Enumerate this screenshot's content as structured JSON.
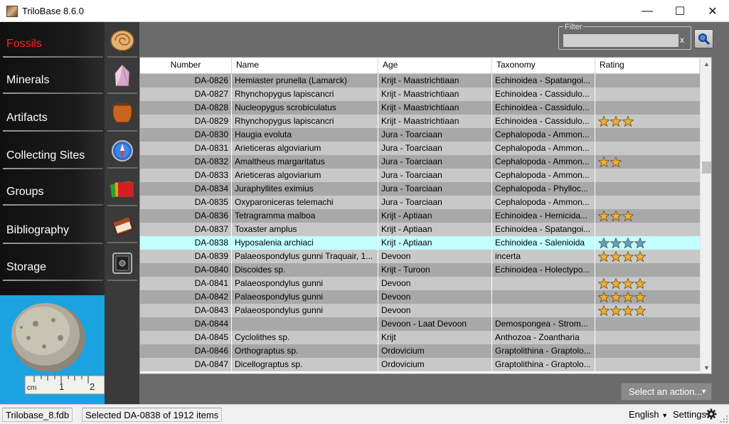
{
  "window": {
    "title": "TriloBase 8.6.0",
    "minimize": "—",
    "maximize": "☐",
    "close": "✕"
  },
  "sidebar": {
    "items": [
      {
        "label": "Fossils",
        "icon": "ammonite-icon",
        "active": true
      },
      {
        "label": "Minerals",
        "icon": "mineral-crystal-icon",
        "active": false
      },
      {
        "label": "Artifacts",
        "icon": "pottery-icon",
        "active": false
      },
      {
        "label": "Collecting Sites",
        "icon": "compass-icon",
        "active": false
      },
      {
        "label": "Groups",
        "icon": "folders-icon",
        "active": false
      },
      {
        "label": "Bibliography",
        "icon": "book-icon",
        "active": false
      },
      {
        "label": "Storage",
        "icon": "safe-icon",
        "active": false
      }
    ],
    "photo_scale_labels": [
      "cm",
      "1",
      "2"
    ]
  },
  "filter": {
    "legend": "Filter",
    "value": "",
    "clear": "x"
  },
  "table": {
    "columns": [
      "Number",
      "Name",
      "Age",
      "Taxonomy",
      "Rating"
    ],
    "rows": [
      {
        "number": "DA-0826",
        "name": "Hemiaster prunella (Lamarck)",
        "age": "Krijt - Maastrichtiaan",
        "taxonomy": "Echinoidea - Spatangoi...",
        "rating": 0
      },
      {
        "number": "DA-0827",
        "name": "Rhynchopygus lapiscancri",
        "age": "Krijt - Maastrichtiaan",
        "taxonomy": "Echinoidea - Cassidulo...",
        "rating": 0
      },
      {
        "number": "DA-0828",
        "name": "Nucleopygus scrobiculatus",
        "age": "Krijt - Maastrichtiaan",
        "taxonomy": "Echinoidea - Cassidulo...",
        "rating": 0
      },
      {
        "number": "DA-0829",
        "name": "Rhynchopygus lapiscancri",
        "age": "Krijt - Maastrichtiaan",
        "taxonomy": "Echinoidea - Cassidulo...",
        "rating": 3
      },
      {
        "number": "DA-0830",
        "name": "Haugia evoluta",
        "age": "Jura - Toarciaan",
        "taxonomy": "Cephalopoda - Ammon...",
        "rating": 0
      },
      {
        "number": "DA-0831",
        "name": "Arieticeras algoviarium",
        "age": "Jura - Toarciaan",
        "taxonomy": "Cephalopoda - Ammon...",
        "rating": 0
      },
      {
        "number": "DA-0832",
        "name": "Amaltheus margaritatus",
        "age": "Jura - Toarciaan",
        "taxonomy": "Cephalopoda - Ammon...",
        "rating": 2
      },
      {
        "number": "DA-0833",
        "name": "Arieticeras algoviarium",
        "age": "Jura - Toarciaan",
        "taxonomy": "Cephalopoda - Ammon...",
        "rating": 0
      },
      {
        "number": "DA-0834",
        "name": "Juraphyllites eximius",
        "age": "Jura - Toarciaan",
        "taxonomy": "Cephalopoda - Phylloc...",
        "rating": 0
      },
      {
        "number": "DA-0835",
        "name": "Oxyparoniceras telemachi",
        "age": "Jura - Toarciaan",
        "taxonomy": "Cephalopoda - Ammon...",
        "rating": 0
      },
      {
        "number": "DA-0836",
        "name": "Tetragramma malboa",
        "age": "Krijt - Aptiaan",
        "taxonomy": "Echinoidea - Hemicida...",
        "rating": 3
      },
      {
        "number": "DA-0837",
        "name": "Toxaster amplus",
        "age": "Krijt - Aptiaan",
        "taxonomy": "Echinoidea - Spatangoi...",
        "rating": 0
      },
      {
        "number": "DA-0838",
        "name": "Hyposalenia archiaci",
        "age": "Krijt - Aptiaan",
        "taxonomy": "Echinoidea - Salenioida",
        "rating": 4,
        "selected": true
      },
      {
        "number": "DA-0839",
        "name": "Palaeospondylus gunni Traquair, 1...",
        "age": "Devoon",
        "taxonomy": "incerta",
        "rating": 4
      },
      {
        "number": "DA-0840",
        "name": "Discoides sp.",
        "age": "Krijt - Turoon",
        "taxonomy": "Echinoidea - Holectypo...",
        "rating": 0
      },
      {
        "number": "DA-0841",
        "name": "Palaeospondylus gunni",
        "age": "Devoon",
        "taxonomy": "",
        "rating": 4
      },
      {
        "number": "DA-0842",
        "name": "Palaeospondylus gunni",
        "age": "Devoon",
        "taxonomy": "",
        "rating": 4
      },
      {
        "number": "DA-0843",
        "name": "Palaeospondylus gunni",
        "age": "Devoon",
        "taxonomy": "",
        "rating": 4
      },
      {
        "number": "DA-0844",
        "name": "",
        "age": "Devoon - Laat Devoon",
        "taxonomy": "Demospongea - Strom...",
        "rating": 0
      },
      {
        "number": "DA-0845",
        "name": "Cyclolithes sp.",
        "age": "Krijt",
        "taxonomy": "Anthozoa - Zoantharia",
        "rating": 0
      },
      {
        "number": "DA-0846",
        "name": "Orthograptus sp.",
        "age": "Ordovicium",
        "taxonomy": "Graptolithina - Graptolo...",
        "rating": 0
      },
      {
        "number": "DA-0847",
        "name": "Dicellograptus sp.",
        "age": "Ordovicium",
        "taxonomy": "Graptolithina - Graptolo...",
        "rating": 0
      }
    ]
  },
  "actions": {
    "label": "Select an action..."
  },
  "status": {
    "database": "Trilobase_8.fdb",
    "selection": "Selected DA-0838 of 1912 items",
    "language": "English",
    "settings": "Settings"
  },
  "colors": {
    "active_nav": "#ff2020",
    "selected_row": "#c2ffff",
    "star_gold": "#f0b030",
    "star_blue": "#5aa0d8"
  }
}
